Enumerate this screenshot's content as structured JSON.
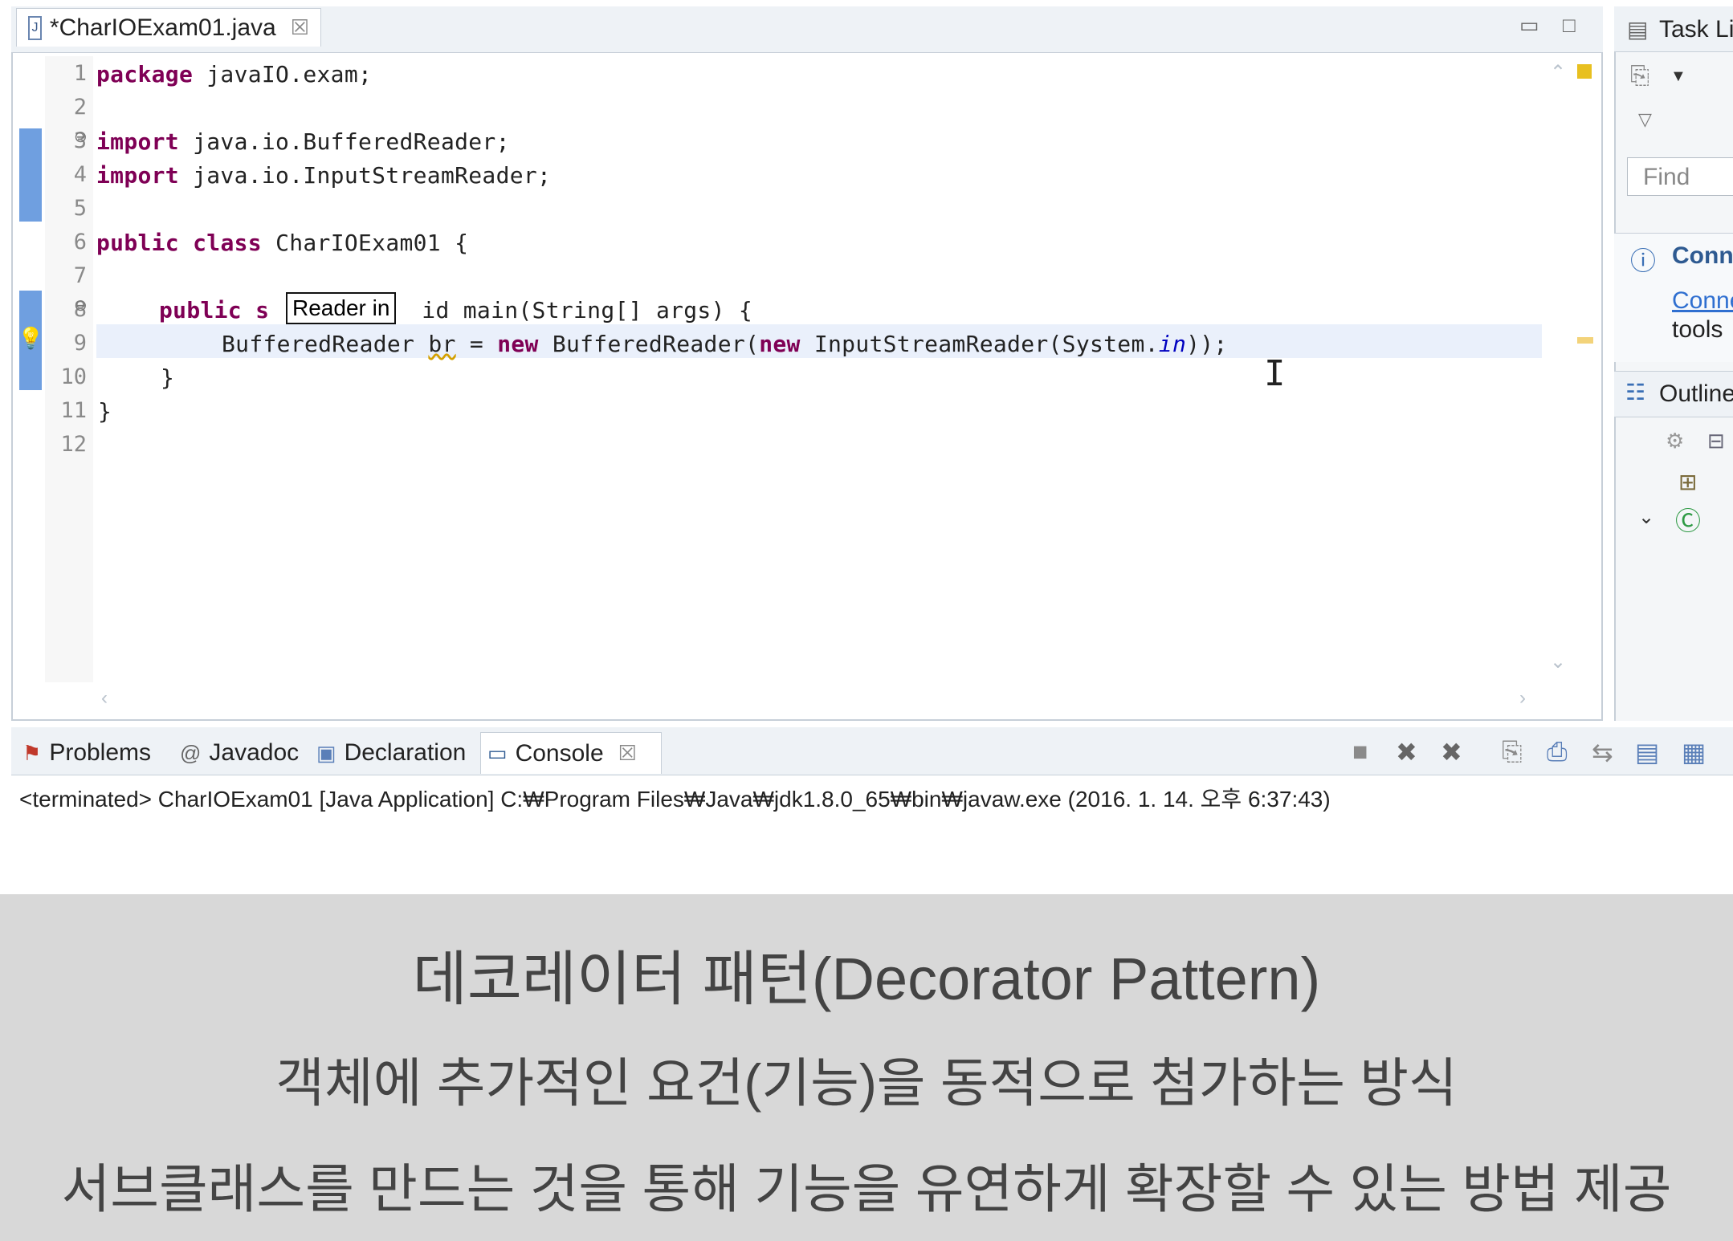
{
  "editor": {
    "tab_title": "*CharIOExam01.java",
    "close_glyph": "☒",
    "minimize_glyph": "▭",
    "maximize_glyph": "□",
    "line_numbers": [
      "1",
      "2",
      "3",
      "4",
      "5",
      "6",
      "7",
      "8",
      "9",
      "10",
      "11",
      "12"
    ],
    "code": {
      "l1_kw": "package",
      "l1_rest": " javaIO.exam;",
      "l3_kw": "import",
      "l3_rest": " java.io.BufferedReader;",
      "l4_kw": "import",
      "l4_rest": " java.io.InputStreamReader;",
      "l6_kw1": "public",
      "l6_kw2": "class",
      "l6_rest": " CharIOExam01 {",
      "l8_kw1": "public",
      "l8_frag": " s",
      "l8_rest": "id main(String[] args) {",
      "l9_a": "BufferedReader ",
      "l9_var": "br",
      "l9_b": " = ",
      "l9_kw1": "new",
      "l9_c": " BufferedReader(",
      "l9_kw2": "new",
      "l9_d": " InputStreamReader(System.",
      "l9_field": "in",
      "l9_e": "));",
      "l10": "}",
      "l11": "}"
    },
    "tooltip": "Reader in"
  },
  "right_panel": {
    "task_list": "Task Li",
    "find_placeholder": "Find",
    "connect_title": "Conn",
    "connect_link": "Conne",
    "connect_text": "tools",
    "outline": "Outline"
  },
  "console": {
    "tabs": [
      {
        "label": "Problems"
      },
      {
        "label": "Javadoc"
      },
      {
        "label": "Declaration"
      },
      {
        "label": "Console"
      }
    ],
    "status": "<terminated> CharIOExam01 [Java Application] C:₩Program Files₩Java₩jdk1.8.0_65₩bin₩javaw.exe (2016. 1. 14. 오후 6:37:43)"
  },
  "subtitles": {
    "line1": "데코레이터 패턴(Decorator Pattern)",
    "line2": "객체에 추가적인 요건(기능)을 동적으로 첨가하는 방식",
    "line3": "서브클래스를 만드는 것을 통해 기능을 유연하게 확장할 수 있는 방법 제공"
  },
  "colors": {
    "keyword": "#7f0055",
    "field": "#0000c0",
    "ruler_mark": "#6f9fe0",
    "current_line": "#eaf0fb",
    "subtitle_bg": "#d8d8d8"
  }
}
